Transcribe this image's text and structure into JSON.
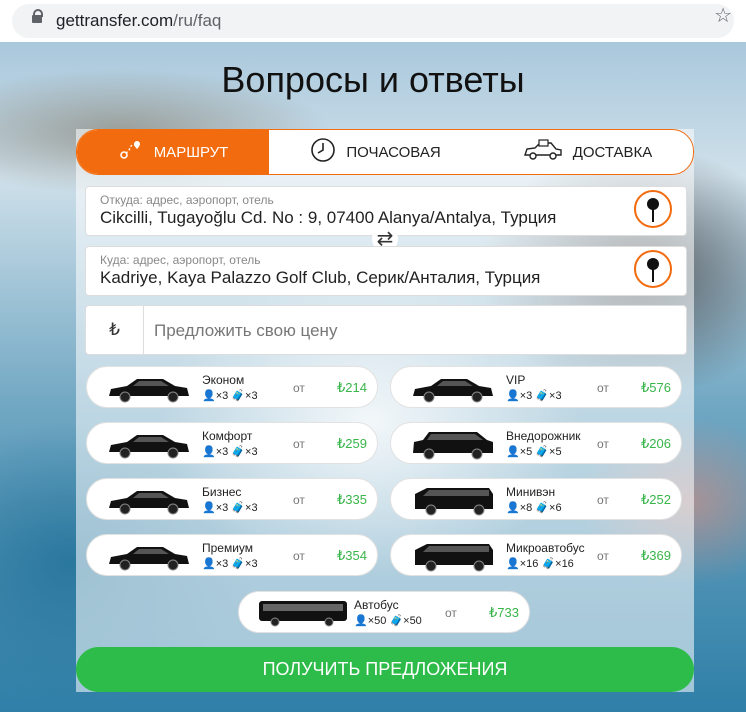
{
  "browser": {
    "url_host": "gettransfer.com",
    "url_path": "/ru/faq"
  },
  "page": {
    "title": "Вопросы и ответы"
  },
  "tabs": [
    {
      "label": "МАРШРУТ",
      "icon": "route-icon",
      "active": true
    },
    {
      "label": "ПОЧАСОВАЯ",
      "icon": "clock-icon",
      "active": false
    },
    {
      "label": "ДОСТАВКА",
      "icon": "delivery-car-icon",
      "active": false
    }
  ],
  "from": {
    "label": "Откуда: адрес, аэропорт, отель",
    "value": "Cikcilli, Tugayoğlu Cd. No : 9, 07400 Alanya/Antalya, Турция"
  },
  "to": {
    "label": "Куда: адрес, аэропорт, отель",
    "value": "Kadriye, Kaya Palazzo Golf Club, Серик/Анталия, Турция"
  },
  "price": {
    "currency": "₺",
    "placeholder": "Предложить свою цену"
  },
  "from_word": "от",
  "vehicles": [
    {
      "name": "Эконом",
      "pax": "×3",
      "bags": "×3",
      "price": "₺214",
      "shape": "sedan"
    },
    {
      "name": "VIP",
      "pax": "×3",
      "bags": "×3",
      "price": "₺576",
      "shape": "sedan"
    },
    {
      "name": "Комфорт",
      "pax": "×3",
      "bags": "×3",
      "price": "₺259",
      "shape": "sedan"
    },
    {
      "name": "Внедорожник",
      "pax": "×5",
      "bags": "×5",
      "price": "₺206",
      "shape": "suv"
    },
    {
      "name": "Бизнес",
      "pax": "×3",
      "bags": "×3",
      "price": "₺335",
      "shape": "sedan"
    },
    {
      "name": "Минивэн",
      "pax": "×8",
      "bags": "×6",
      "price": "₺252",
      "shape": "van"
    },
    {
      "name": "Премиум",
      "pax": "×3",
      "bags": "×3",
      "price": "₺354",
      "shape": "sedan"
    },
    {
      "name": "Микроавтобус",
      "pax": "×16",
      "bags": "×16",
      "price": "₺369",
      "shape": "van"
    },
    {
      "name": "Автобус",
      "pax": "×50",
      "bags": "×50",
      "price": "₺733",
      "shape": "bus"
    }
  ],
  "submit_label": "ПОЛУЧИТЬ ПРЕДЛОЖЕНИЯ",
  "colors": {
    "accent": "#f26b0e",
    "success": "#2dbb49",
    "price_green": "#39b54a"
  }
}
